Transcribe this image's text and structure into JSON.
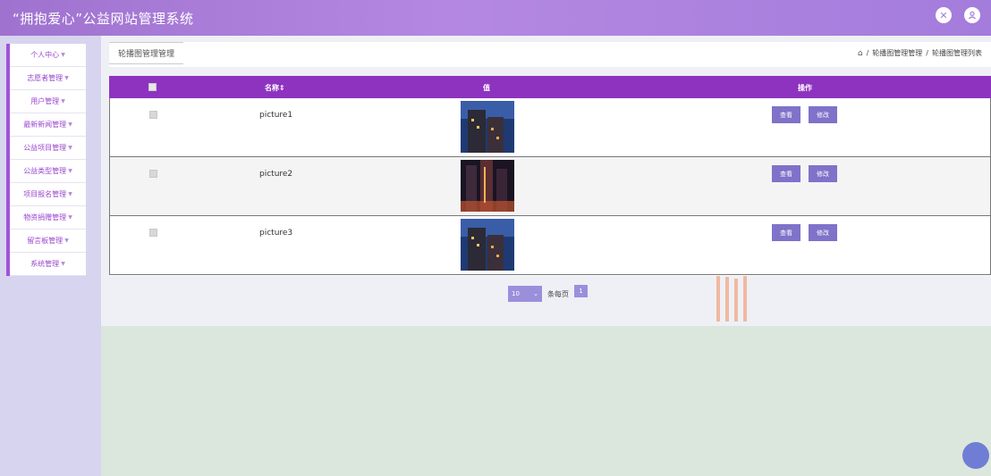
{
  "header": {
    "title": "“拥抱爱心”公益网站管理系统",
    "icons": [
      "fullscreen-icon",
      "user-icon"
    ]
  },
  "sidebar": {
    "items": [
      {
        "label": "个人中心"
      },
      {
        "label": "志愿者管理"
      },
      {
        "label": "用户管理"
      },
      {
        "label": "最新新闻管理"
      },
      {
        "label": "公益项目管理"
      },
      {
        "label": "公益类型管理"
      },
      {
        "label": "项目报名管理"
      },
      {
        "label": "物资捐赠管理"
      },
      {
        "label": "留言板管理"
      },
      {
        "label": "系统管理"
      }
    ],
    "caret": "▼"
  },
  "tabs": {
    "active": "轮播图管理管理"
  },
  "breadcrumb": {
    "level1": "轮播图管理管理",
    "level2": "轮播图管理列表",
    "separator": "/"
  },
  "table": {
    "columns": {
      "name": "名称⇕",
      "value": "值",
      "actions": "操作"
    },
    "rows": [
      {
        "name": "picture1",
        "view": "查看",
        "edit": "修改"
      },
      {
        "name": "picture2",
        "view": "查看",
        "edit": "修改"
      },
      {
        "name": "picture3",
        "view": "查看",
        "edit": "修改"
      }
    ]
  },
  "pagination": {
    "page_size": "10",
    "per_page_label": "条每页",
    "current_page": "1"
  },
  "colors": {
    "header_gradient_start": "#9f72cf",
    "table_header": "#8e33c0",
    "button": "#7f72c9",
    "sidebar_text": "#9b46cf"
  }
}
